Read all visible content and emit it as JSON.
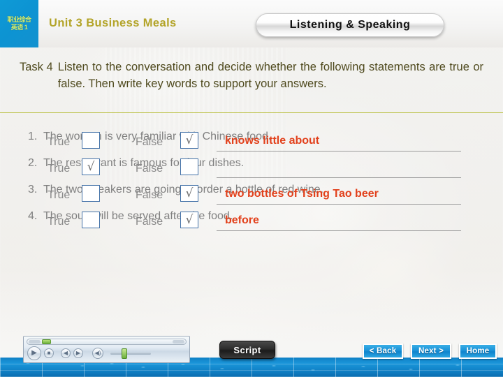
{
  "header": {
    "logo": {
      "line1": "职业综合",
      "line2": "英语 1",
      "name": "vocational-english-logo"
    },
    "unit_title": "Unit 3 Business Meals",
    "section_pill": "Listening & Speaking",
    "accent_title_color": "#b3a429",
    "logo_bg_color": "#0d93d2"
  },
  "task": {
    "label": "Task 4",
    "text": "Listen to the conversation and decide whether the following statements are true or false. Then write key words to support your answers.",
    "text_color": "#4f4a1e"
  },
  "divider_color": "#b9bf3e",
  "labels": {
    "true": "True",
    "false": "False",
    "check_glyph": "√"
  },
  "questions": [
    {
      "number": "1.",
      "statement": "The woman is very familiar with Chinese food.",
      "true_checked": false,
      "false_checked": true,
      "answer": "knows little about"
    },
    {
      "number": "2.",
      "statement": "The restaurant is famous for four dishes.",
      "true_checked": true,
      "false_checked": false,
      "answer": ""
    },
    {
      "number": "3.",
      "statement": "The two speakers are going to order a bottle of red wine.",
      "true_checked": false,
      "false_checked": true,
      "answer": "two bottles of Tsing Tao beer"
    },
    {
      "number": "4.",
      "statement": "The soup will be served after the food.",
      "true_checked": false,
      "false_checked": true,
      "answer": "before"
    }
  ],
  "answer_color": "#e2411c",
  "question_text_color": "#808080",
  "player": {
    "play_icon": "play-icon",
    "stop_icon": "stop-icon",
    "previous_icon": "previous-track-icon",
    "next_icon": "next-track-icon",
    "mute_icon": "mute-speaker-icon",
    "play_glyph": "▶",
    "stop_glyph": "■",
    "previous_glyph": "◀",
    "next_glyph": "▶",
    "mute_glyph": "◀)"
  },
  "footer": {
    "script_label": "Script",
    "back_label": "< Back",
    "next_label": "Next >",
    "home_label": "Home",
    "strip_color": "#1388cd"
  }
}
